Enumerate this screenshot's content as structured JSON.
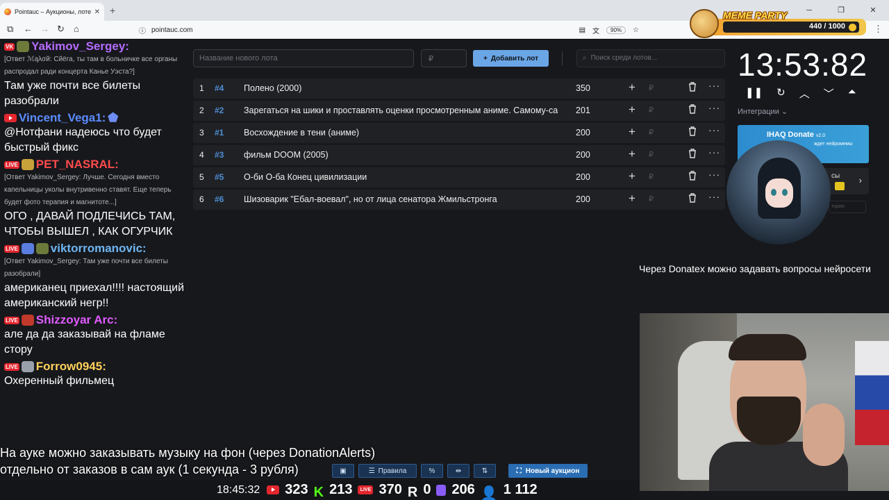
{
  "browser": {
    "tab_title": "Pointauc – Аукционы, лотереи",
    "url": "pointauc.com",
    "zoom": "90%"
  },
  "meme_party": {
    "title": "MEME PARTY",
    "progress_text": "440 / 1000",
    "progress_value": 440,
    "progress_max": 1000
  },
  "chat": [
    {
      "author": "Yakimov_Sergey:",
      "author_color": "#b56cff",
      "reply": "[Ответ ℳąλσй: Сйёга, ты там в больничке все органы распродал ради концерта Канье Уэста?]",
      "text": "Там уже почти все билеты разобрали"
    },
    {
      "author": "Vincent_Vega1:",
      "author_color": "#5b8cff",
      "reply": "",
      "text": "@Нотфани надеюсь что будет быстрый фикс"
    },
    {
      "author": "PET_NASRAL:",
      "author_color": "#ff4b4b",
      "reply": "[Ответ Yakimov_Sergey: Лучше. Сегодня вместо капельницы уколы внутривенно ставят. Еще теперь будет фото терапия и магнитоте...]",
      "text": "ОГО , ДАВАЙ ПОДЛЕЧИСЬ ТАМ, ЧТОБЫ ВЫШЕЛ , КАК ОГУРЧИК"
    },
    {
      "author": "viktorromanovic:",
      "author_color": "#6fb5f2",
      "reply": "[Ответ Yakimov_Sergey: Там уже почти все билеты разобрали]",
      "text": "американец приехал!!!! настоящий американский негр!!"
    },
    {
      "author": "Shizzoyar Arc:",
      "author_color": "#e05bff",
      "reply": "",
      "text": "але да да заказывай на фламе стору"
    },
    {
      "author": "Forrow0945:",
      "author_color": "#ffd15b",
      "reply": "",
      "text": "Охеренный фильмец"
    }
  ],
  "auction": {
    "lot_placeholder": "Название нового лота",
    "price_placeholder": "₽",
    "add_label": "Добавить лот",
    "search_placeholder": "Поиск среди лотов...",
    "lots": [
      {
        "n": "1",
        "id": "#4",
        "name": "Полено (2000)",
        "amount": "350"
      },
      {
        "n": "2",
        "id": "#2",
        "name": "Зарегаться на шики и проставлять оценки просмотренным аниме. Самому-са",
        "amount": "201"
      },
      {
        "n": "3",
        "id": "#1",
        "name": "Восхождение в тени (аниме)",
        "amount": "200"
      },
      {
        "n": "4",
        "id": "#3",
        "name": "фильм DOOM (2005)",
        "amount": "200"
      },
      {
        "n": "5",
        "id": "#5",
        "name": "О-би О-ба Конец цивилизации",
        "amount": "200"
      },
      {
        "n": "6",
        "id": "#6",
        "name": "Шизоварик \"Ебал-воевал\", но от лица сенатора Жмильстронга",
        "amount": "200"
      }
    ]
  },
  "timer": {
    "value": "13:53:82",
    "integrations_label": "Интеграции"
  },
  "donate_card": {
    "title": "IHAQ Donate",
    "version": "v2.0",
    "subtitle": "ждет нейромемы"
  },
  "card2_label": "сы",
  "tiny_input": "тории",
  "donatex_text": "Через Donatex можно задавать вопросы нейросети",
  "caption": {
    "line1": "На ауке можно заказывать музыку на фон (через DonationAlerts)",
    "line2": "отдельно от заказов в сам аук (1 секунда - 3 рубля)"
  },
  "toolbar": {
    "rules_label": "Правила",
    "new_auction_label": "Новый аукцион"
  },
  "stats": {
    "clock": "18:45:32",
    "youtube": "323",
    "kick": "213",
    "vk_live": "370",
    "rutube": "0",
    "twitch": "206",
    "total": "1 112"
  }
}
